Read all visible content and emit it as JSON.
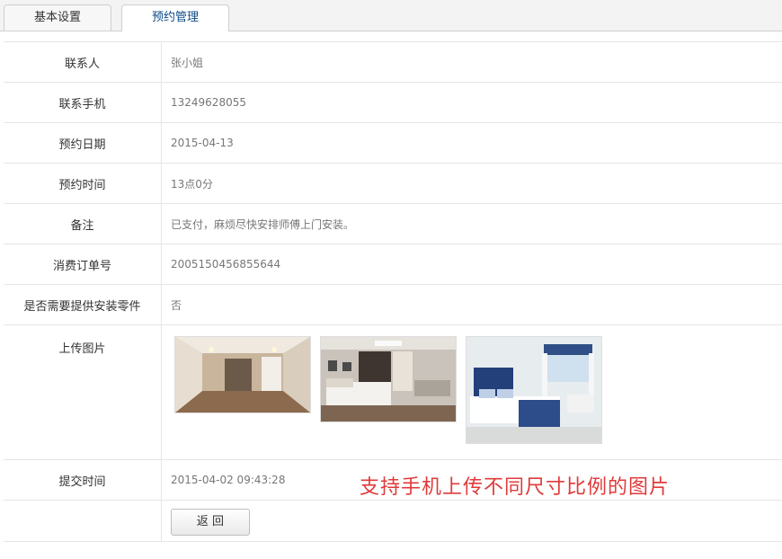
{
  "tabs": [
    {
      "label": "基本设置"
    },
    {
      "label": "预约管理"
    }
  ],
  "fields": {
    "contact": {
      "label": "联系人",
      "value": "张小姐"
    },
    "phone": {
      "label": "联系手机",
      "value": "13249628055"
    },
    "date": {
      "label": "预约日期",
      "value": "2015-04-13"
    },
    "time": {
      "label": "预约时间",
      "value": "13点0分"
    },
    "remark": {
      "label": "备注",
      "value": "已支付，麻烦尽快安排师傅上门安装。"
    },
    "order_no": {
      "label": "消费订单号",
      "value": "2005150456855644"
    },
    "need_parts": {
      "label": "是否需要提供安装零件",
      "value": "否"
    },
    "images": {
      "label": "上传图片"
    },
    "submit_time": {
      "label": "提交时间",
      "value": "2015-04-02 09:43:28"
    }
  },
  "annotation": "支持手机上传不同尺寸比例的图片",
  "back_button": {
    "label": "返 回"
  }
}
